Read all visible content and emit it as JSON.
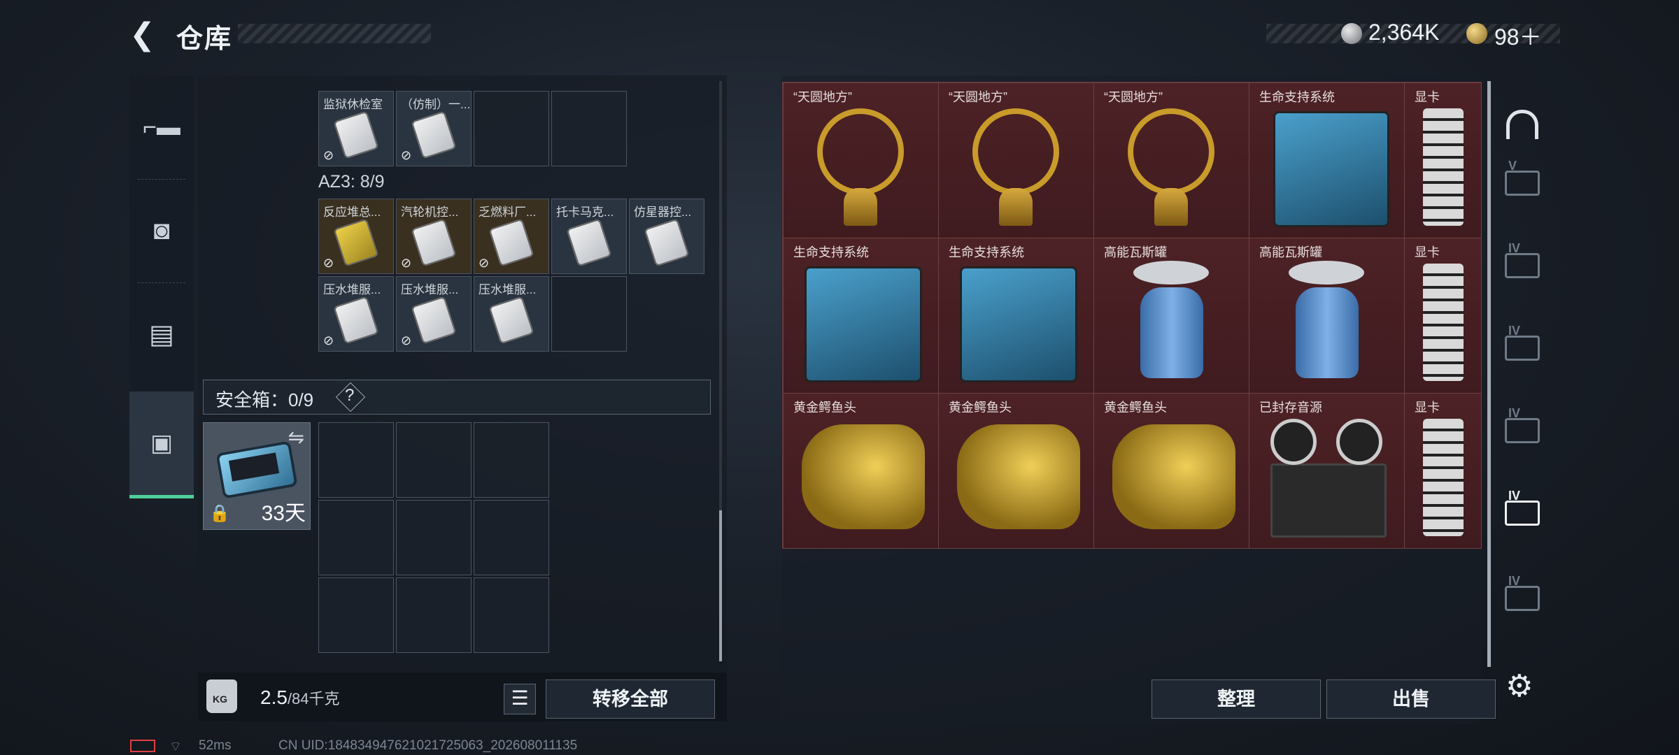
{
  "header": {
    "back_glyph": "❮",
    "title": "仓库",
    "currency1": "2,364K",
    "currency2": "98＋"
  },
  "nav": {
    "items": [
      {
        "name": "weapon",
        "glyph": "🔫"
      },
      {
        "name": "armor",
        "glyph": "▣"
      },
      {
        "name": "backpack",
        "glyph": "▤"
      },
      {
        "name": "safebox",
        "glyph": "💼"
      }
    ]
  },
  "inventory": {
    "top_row": [
      {
        "name": "监狱休检室"
      },
      {
        "name": "（仿制）一..."
      }
    ],
    "az3_label": "AZ3: 8/9",
    "az3_row1": [
      {
        "name": "反应堆总..."
      },
      {
        "name": "汽轮机控..."
      },
      {
        "name": "乏燃料厂..."
      },
      {
        "name": "托卡马克..."
      },
      {
        "name": "仿星器控..."
      }
    ],
    "az3_row2": [
      {
        "name": "压水堆服..."
      },
      {
        "name": "压水堆服..."
      },
      {
        "name": "压水堆服..."
      }
    ],
    "safe_label": "安全箱：0/9",
    "safe_help": "?",
    "safe_case_days": "33天"
  },
  "footer": {
    "kg_icon_text": "KG",
    "weight_current": "2.5",
    "weight_max": "/84千克",
    "transfer_all": "转移全部",
    "sort": "整理",
    "sell": "出售"
  },
  "status": {
    "ping": "52ms",
    "uid": "CN UID:18483494762102172506​3_202608011135"
  },
  "storage_grid": {
    "row1": [
      "“天圆地方”",
      "“天圆地方”",
      "“天圆地方”",
      "生命支持系统",
      "显卡"
    ],
    "row2": [
      "生命支持系统",
      "生命支持系统",
      "高能瓦斯罐",
      "高能瓦斯罐",
      "显卡"
    ],
    "row3": [
      "黄金鳄鱼头",
      "黄金鳄鱼头",
      "黄金鳄鱼头",
      "已封存音源",
      "显卡"
    ]
  },
  "right_tabs": [
    "V",
    "IV",
    "IV",
    "IV",
    "IV",
    "IV"
  ]
}
